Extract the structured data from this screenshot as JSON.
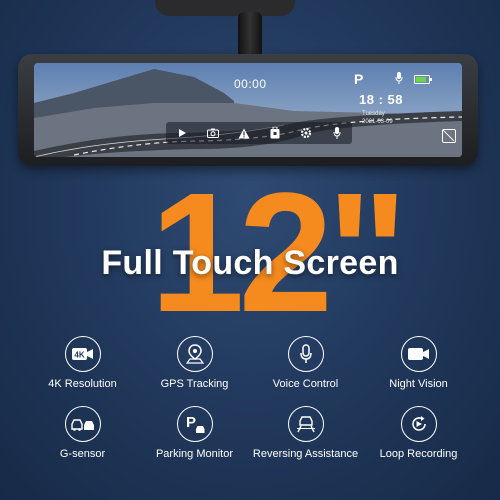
{
  "screen": {
    "record_time": "00:00",
    "parking_letter": "P",
    "clock": "18 : 58",
    "date_line_1": "Tuesday",
    "date_line_2": "2021-03-09"
  },
  "hero": {
    "size_text": "12\"",
    "headline": "Full Touch Screen"
  },
  "features": [
    {
      "label": "4K Resolution",
      "icon": "4k-icon",
      "badge": "4K"
    },
    {
      "label": "GPS Tracking",
      "icon": "gps-pin-icon"
    },
    {
      "label": "Voice Control",
      "icon": "microphone-icon"
    },
    {
      "label": "Night Vision",
      "icon": "night-camera-icon"
    },
    {
      "label": "G-sensor",
      "icon": "car-collision-icon"
    },
    {
      "label": "Parking Monitor",
      "icon": "parking-icon",
      "badge": "P"
    },
    {
      "label": "Reversing Assistance",
      "icon": "reverse-guide-icon"
    },
    {
      "label": "Loop Recording",
      "icon": "loop-recording-icon"
    }
  ],
  "colors": {
    "accent_orange": "#f58a1f",
    "background": "#223a5e"
  }
}
